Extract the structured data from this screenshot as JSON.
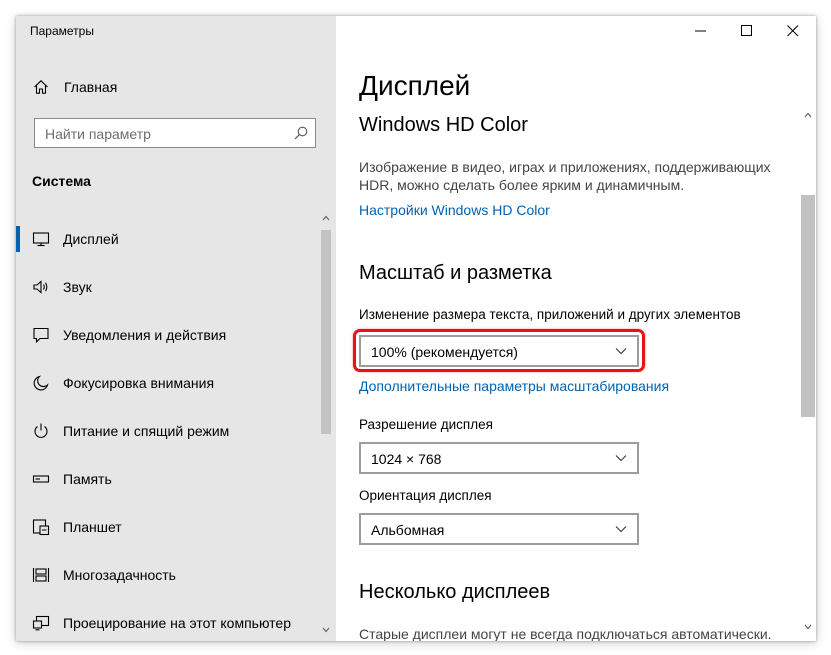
{
  "window": {
    "title": "Параметры"
  },
  "sidebar": {
    "home_label": "Главная",
    "search_placeholder": "Найти параметр",
    "section_header": "Система",
    "items": [
      {
        "label": "Дисплей",
        "icon": "monitor-icon",
        "selected": true
      },
      {
        "label": "Звук",
        "icon": "speaker-icon",
        "selected": false
      },
      {
        "label": "Уведомления и действия",
        "icon": "notification-icon",
        "selected": false
      },
      {
        "label": "Фокусировка внимания",
        "icon": "moon-icon",
        "selected": false
      },
      {
        "label": "Питание и спящий режим",
        "icon": "power-icon",
        "selected": false
      },
      {
        "label": "Память",
        "icon": "storage-icon",
        "selected": false
      },
      {
        "label": "Планшет",
        "icon": "tablet-icon",
        "selected": false
      },
      {
        "label": "Многозадачность",
        "icon": "multitasking-icon",
        "selected": false
      },
      {
        "label": "Проецирование на этот компьютер",
        "icon": "projection-icon",
        "selected": false
      }
    ]
  },
  "content": {
    "page_title": "Дисплей",
    "hd_color": {
      "heading": "Windows HD Color",
      "description": "Изображение в видео, играх и приложениях, поддерживающих HDR, можно сделать более ярким и динамичным.",
      "link": "Настройки Windows HD Color"
    },
    "scale_layout": {
      "heading": "Масштаб и разметка",
      "scale_label": "Изменение размера текста, приложений и других элементов",
      "scale_value": "100% (рекомендуется)",
      "advanced_link": "Дополнительные параметры масштабирования",
      "resolution_label": "Разрешение дисплея",
      "resolution_value": "1024 × 768",
      "orientation_label": "Ориентация дисплея",
      "orientation_value": "Альбомная"
    },
    "multiple_displays": {
      "heading": "Несколько дисплеев",
      "text": "Старые дисплеи могут не всегда подключаться автоматически."
    }
  },
  "colors": {
    "accent": "#0063b1",
    "highlight": "#e8121b",
    "sidebar_bg": "#e6e6e6"
  }
}
